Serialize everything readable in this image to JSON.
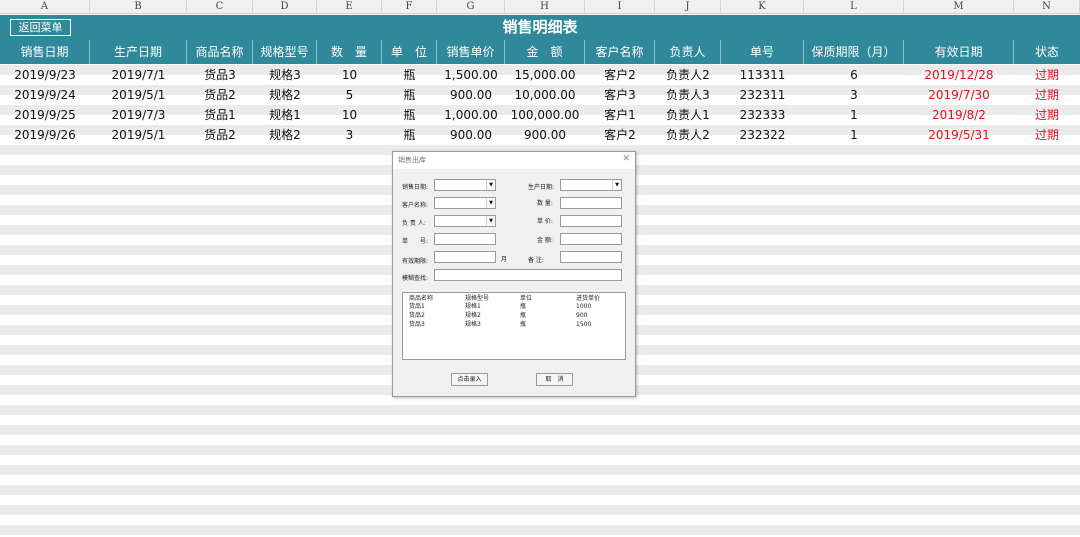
{
  "column_letters": [
    "A",
    "B",
    "C",
    "D",
    "E",
    "F",
    "G",
    "H",
    "I",
    "J",
    "K",
    "L",
    "M",
    "N"
  ],
  "title": "销售明细表",
  "back_button": "返回菜单",
  "headers": [
    "销售日期",
    "生产日期",
    "商品名称",
    "规格型号",
    "数　量",
    "单　位",
    "销售单价",
    "金　额",
    "客户名称",
    "负责人",
    "单号",
    "保质期限（月）",
    "有效日期",
    "状态"
  ],
  "rows": [
    [
      "2019/9/23",
      "2019/7/1",
      "货品3",
      "规格3",
      "10",
      "瓶",
      "1,500.00",
      "15,000.00",
      "客户2",
      "负责人2",
      "113311",
      "6",
      "2019/12/28",
      "过期"
    ],
    [
      "2019/9/24",
      "2019/5/1",
      "货品2",
      "规格2",
      "5",
      "瓶",
      "900.00",
      "10,000.00",
      "客户3",
      "负责人3",
      "232311",
      "3",
      "2019/7/30",
      "过期"
    ],
    [
      "2019/9/25",
      "2019/7/3",
      "货品1",
      "规格1",
      "10",
      "瓶",
      "1,000.00",
      "100,000.00",
      "客户1",
      "负责人1",
      "232333",
      "1",
      "2019/8/2",
      "过期"
    ],
    [
      "2019/9/26",
      "2019/5/1",
      "货品2",
      "规格2",
      "3",
      "瓶",
      "900.00",
      "900.00",
      "客户2",
      "负责人2",
      "232322",
      "1",
      "2019/5/31",
      "过期"
    ]
  ],
  "dialog": {
    "title": "销售出库",
    "close": "✕",
    "labels": {
      "sale_date": "销售日期:",
      "prod_date": "生产日期:",
      "customer": "客户名称:",
      "quantity": "数 量:",
      "manager": "负 责 人:",
      "unit_price": "单 价:",
      "order_no": "单　　号:",
      "amount": "金 额:",
      "validity": "有效期限:",
      "month": "月",
      "remark": "备 注:",
      "fuzzy": "模糊查找:"
    },
    "list_headers": [
      "商品名称",
      "规格型号",
      "单位",
      "进货单价"
    ],
    "list_rows": [
      [
        "货品1",
        "规格1",
        "瓶",
        "1000"
      ],
      [
        "货品2",
        "规格2",
        "瓶",
        "900"
      ],
      [
        "货品3",
        "规格3",
        "瓶",
        "1500"
      ]
    ],
    "btn_entry": "点击录入",
    "btn_cancel": "取　消"
  },
  "colors": {
    "teal": "#30889b",
    "red": "#e0141e",
    "band": "#ebebeb"
  }
}
